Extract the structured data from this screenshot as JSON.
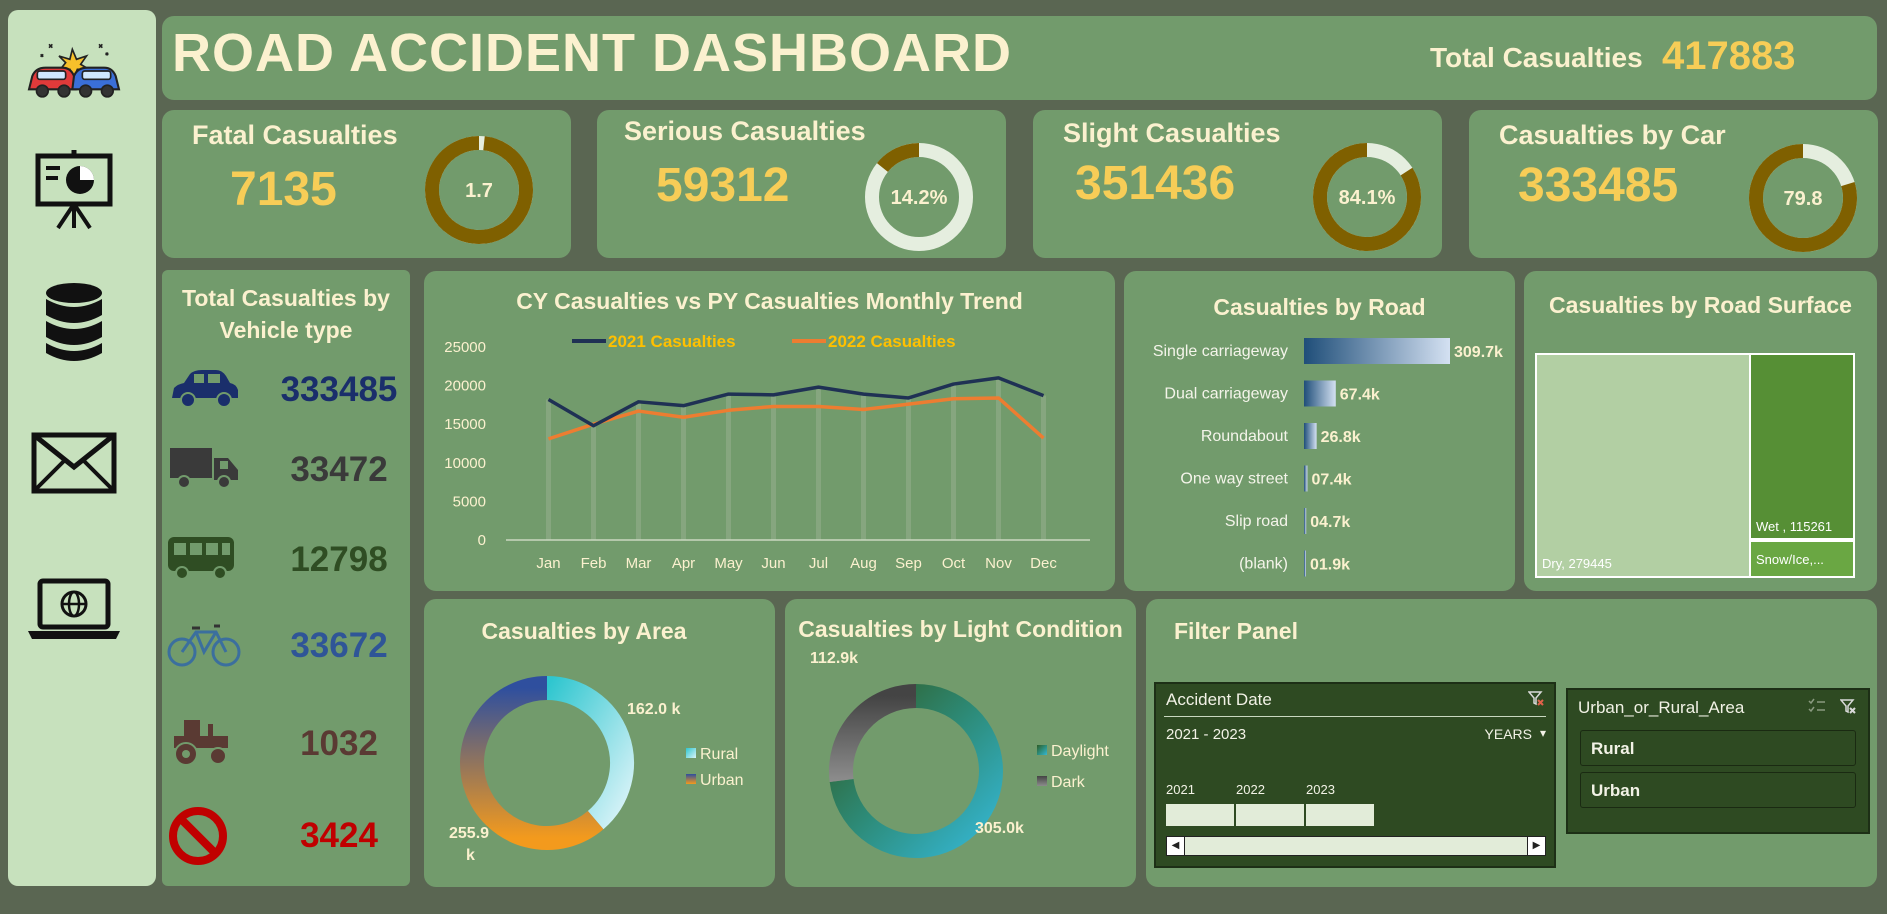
{
  "header": {
    "title": "ROAD ACCIDENT DASHBOARD",
    "total_label": "Total Casualties",
    "total_value": "417883"
  },
  "sidebar": {
    "icons": [
      "car-crash-icon",
      "presentation-icon",
      "database-icon",
      "mail-icon",
      "laptop-globe-icon"
    ]
  },
  "kpis": [
    {
      "label": "Fatal Casualties",
      "value": "7135",
      "donut_text": "1.7",
      "percent": 1.7
    },
    {
      "label": "Serious Casualties",
      "value": "59312",
      "donut_text": "14.2%",
      "percent": 14.2
    },
    {
      "label": "Slight Casualties",
      "value": "351436",
      "donut_text": "84.1%",
      "percent": 84.1
    },
    {
      "label": "Casualties by Car",
      "value": "333485",
      "donut_text": "79.8",
      "percent": 79.8
    }
  ],
  "vehicle": {
    "title_line1": "Total Casualties by",
    "title_line2": "Vehicle type",
    "items": [
      {
        "icon": "car-icon",
        "value": "333485",
        "color": "#1a2e6b"
      },
      {
        "icon": "truck-icon",
        "value": "33472",
        "color": "#3a3a3a"
      },
      {
        "icon": "bus-icon",
        "value": "12798",
        "color": "#2f4d23"
      },
      {
        "icon": "bicycle-icon",
        "value": "33672",
        "color": "#2f5597"
      },
      {
        "icon": "tractor-icon",
        "value": "1032",
        "color": "#5a3a33"
      },
      {
        "icon": "no-entry-icon",
        "value": "3424",
        "color": "#c00000"
      }
    ]
  },
  "charts": {
    "trend_title": "CY Casualties vs PY Casualties Monthly Trend",
    "road_title": "Casualties by Road",
    "surface_title": "Casualties by Road Surface",
    "area_title": "Casualties by Area",
    "light_title": "Casualties by Light Condition"
  },
  "chart_data": [
    {
      "type": "line",
      "title": "CY Casualties vs PY Casualties Monthly Trend",
      "categories": [
        "Jan",
        "Feb",
        "Mar",
        "Apr",
        "May",
        "Jun",
        "Jul",
        "Aug",
        "Sep",
        "Oct",
        "Nov",
        "Dec"
      ],
      "ylim": [
        0,
        25000
      ],
      "yticks": [
        "25000",
        "20000",
        "15000",
        "10000",
        "5000",
        "0"
      ],
      "series": [
        {
          "name": "2021 Casualties",
          "color": "#1f3154",
          "values": [
            18200,
            14800,
            17900,
            17400,
            18900,
            18800,
            19800,
            18900,
            18400,
            20200,
            21000,
            18700
          ]
        },
        {
          "name": "2022 Casualties",
          "color": "#ed7d31",
          "values": [
            13100,
            15000,
            16700,
            15900,
            16800,
            17300,
            17300,
            16900,
            17600,
            18300,
            18400,
            13200
          ]
        }
      ],
      "legend": "top"
    },
    {
      "type": "bar",
      "title": "Casualties by Road",
      "categories": [
        "Single carriageway",
        "Dual carriageway",
        "Roundabout",
        "One way street",
        "Slip road",
        "(blank)"
      ],
      "values": [
        309.7,
        67.4,
        26.8,
        7.4,
        4.7,
        1.9
      ],
      "labels": [
        "309.7k",
        "67.4k",
        "26.8k",
        "07.4k",
        "04.7k",
        "01.9k"
      ]
    },
    {
      "type": "heatmap",
      "title": "Casualties by Road Surface",
      "items": [
        {
          "name": "Dry",
          "value": 279445,
          "label": "Dry, 279445"
        },
        {
          "name": "Wet",
          "value": 115261,
          "label": "Wet , 115261"
        },
        {
          "name": "Snow/Ice",
          "label": "Snow/Ice,..."
        }
      ]
    },
    {
      "type": "pie",
      "title": "Casualties by Area",
      "labels": [
        "Rural",
        "Urban"
      ],
      "values": [
        162.0,
        255.9
      ],
      "value_labels": [
        "162.0 k",
        "255.9 k"
      ]
    },
    {
      "type": "pie",
      "title": "Casualties by Light Condition",
      "labels": [
        "Daylight",
        "Dark"
      ],
      "values": [
        305.0,
        112.9
      ],
      "value_labels": [
        "305.0k",
        "112.9k"
      ]
    }
  ],
  "filter": {
    "title": "Filter Panel",
    "date_slicer": {
      "title": "Accident Date",
      "range": "2021 - 2023",
      "level": "YEARS",
      "years": [
        "2021",
        "2022",
        "2023"
      ]
    },
    "area_slicer": {
      "title": "Urban_or_Rural_Area",
      "items": [
        "Rural",
        "Urban"
      ]
    }
  }
}
